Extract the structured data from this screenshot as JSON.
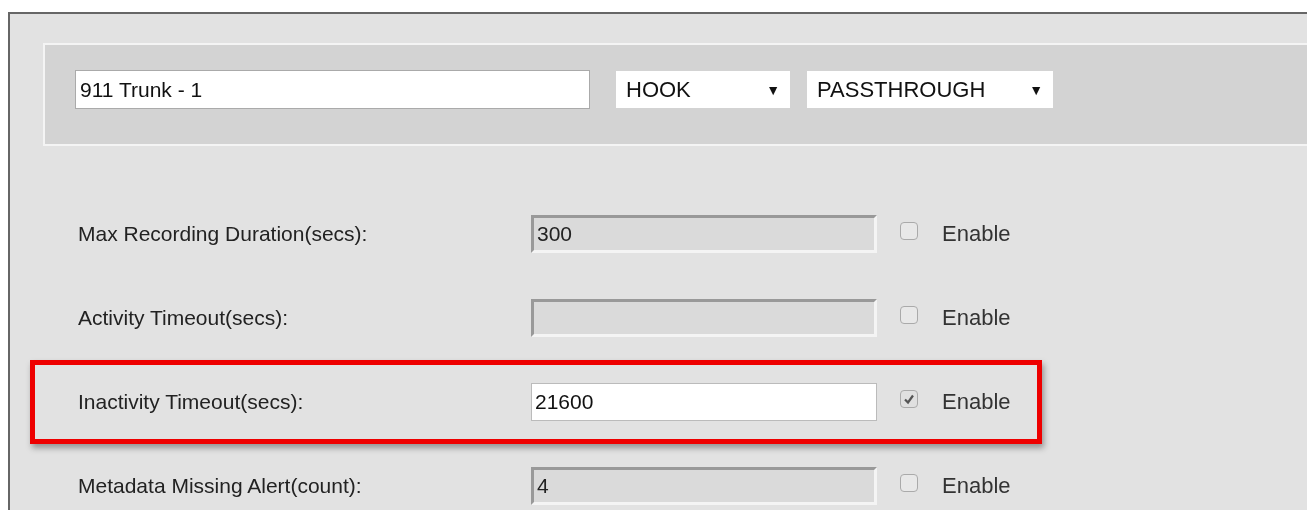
{
  "header": {
    "name_field": {
      "value": "911 Trunk - 1"
    },
    "selects": [
      {
        "value": "HOOK",
        "arrow": "▼"
      },
      {
        "value": "PASSTHROUGH",
        "arrow": "▼"
      }
    ]
  },
  "settings": [
    {
      "label": "Max Recording Duration(secs):",
      "value": "300",
      "disabled": true,
      "checked": false,
      "checkbox_label": "Enable",
      "highlighted": false
    },
    {
      "label": "Activity Timeout(secs):",
      "disabled": true,
      "checked": false,
      "checkbox_label": "Enable",
      "highlighted": false
    },
    {
      "label": "Inactivity Timeout(secs):",
      "value": "21600",
      "disabled": false,
      "checked": true,
      "checkbox_label": "Enable",
      "highlighted": true
    },
    {
      "label": "Metadata Missing Alert(count):",
      "value": "4",
      "disabled": true,
      "checked": false,
      "checkbox_label": "Enable",
      "highlighted": false
    }
  ]
}
